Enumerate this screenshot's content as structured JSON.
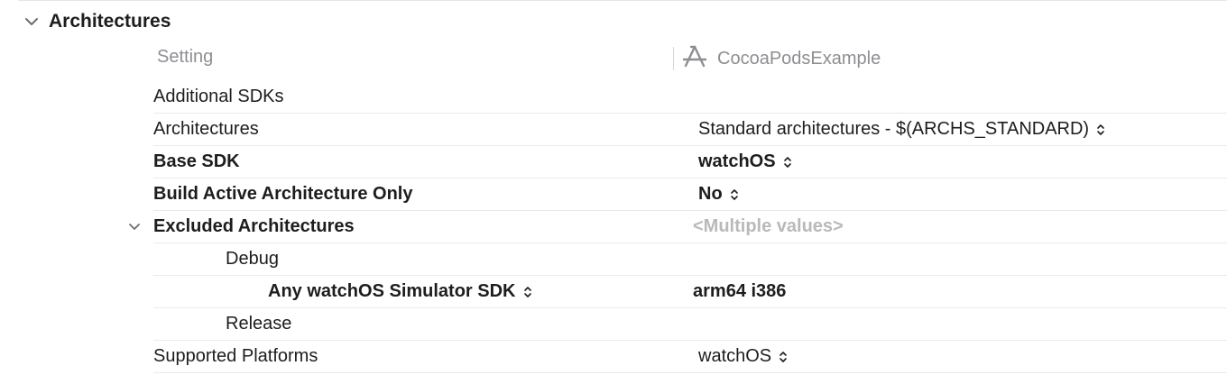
{
  "section": {
    "title": "Architectures",
    "expanded": true,
    "chevron_icon": "chevron-down-icon"
  },
  "columns": {
    "setting": "Setting",
    "target": "CocoaPodsExample",
    "target_icon": "app-target-icon"
  },
  "rows": [
    {
      "name": "Additional SDKs",
      "value": ""
    },
    {
      "name": "Architectures",
      "value": "Standard architectures  -  $(ARCHS_STANDARD)"
    },
    {
      "name": "Base SDK",
      "value": "watchOS"
    },
    {
      "name": "Build Active Architecture Only",
      "value": "No"
    },
    {
      "name": "Excluded Architectures",
      "value": "<Multiple values>"
    },
    {
      "name": "Debug",
      "value": ""
    },
    {
      "name": "Any watchOS Simulator SDK",
      "value": "arm64 i386"
    },
    {
      "name": "Release",
      "value": ""
    },
    {
      "name": "Supported Platforms",
      "value": "watchOS"
    }
  ],
  "colors": {
    "text": "#1d1d1f",
    "secondary": "#8e8e93",
    "placeholder": "#b9b9bd",
    "divider": "#ebebeb"
  }
}
